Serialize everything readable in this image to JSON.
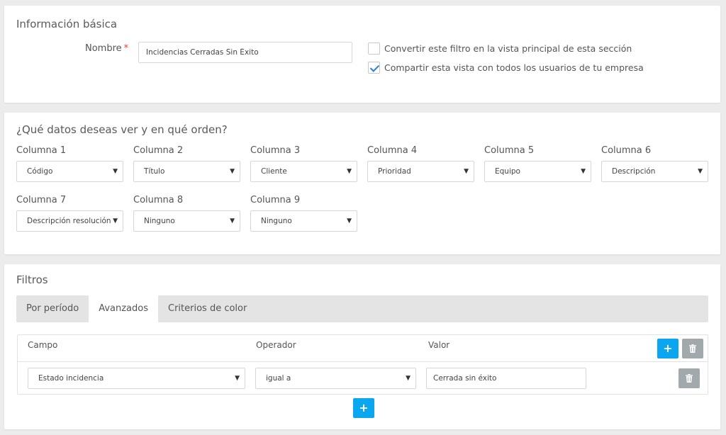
{
  "basic_info": {
    "title": "Información básica",
    "name_label": "Nombre",
    "required_mark": "*",
    "name_value": "Incidencias Cerradas Sin Éxito",
    "option_main_view": {
      "label": "Convertir este filtro en la vista principal de esta sección",
      "checked": false
    },
    "option_share": {
      "label": "Compartir esta vista con todos los usuarios de tu empresa",
      "checked": true
    }
  },
  "columns": {
    "title": "¿Qué datos deseas ver y en qué orden?",
    "items": [
      {
        "label": "Columna 1",
        "value": "Código"
      },
      {
        "label": "Columna 2",
        "value": "Título"
      },
      {
        "label": "Columna 3",
        "value": "Cliente"
      },
      {
        "label": "Columna 4",
        "value": "Prioridad"
      },
      {
        "label": "Columna 5",
        "value": "Equipo"
      },
      {
        "label": "Columna 6",
        "value": "Descripción"
      },
      {
        "label": "Columna 7",
        "value": "Descripción resolución"
      },
      {
        "label": "Columna 8",
        "value": "Ninguno"
      },
      {
        "label": "Columna 9",
        "value": "Ninguno"
      }
    ]
  },
  "filters": {
    "title": "Filtros",
    "tabs": [
      {
        "label": "Por período",
        "active": false
      },
      {
        "label": "Avanzados",
        "active": true
      },
      {
        "label": "Criterios de color",
        "active": false
      }
    ],
    "headers": {
      "field": "Campo",
      "operator": "Operador",
      "value": "Valor"
    },
    "rows": [
      {
        "field": "Estado incidencia",
        "operator": "igual a",
        "value": "Cerrada sin éxito"
      }
    ],
    "add_symbol": "+",
    "caret_symbol": "▼"
  },
  "colors": {
    "accent": "#0aa7f0",
    "muted_button": "#a2a9ad",
    "check": "#2f7fd1",
    "required": "#e53935",
    "page_bg": "#ececec"
  },
  "icons": {
    "add": "plus-icon",
    "delete": "trash-icon",
    "dropdown": "chevron-down-icon",
    "check": "check-icon"
  }
}
